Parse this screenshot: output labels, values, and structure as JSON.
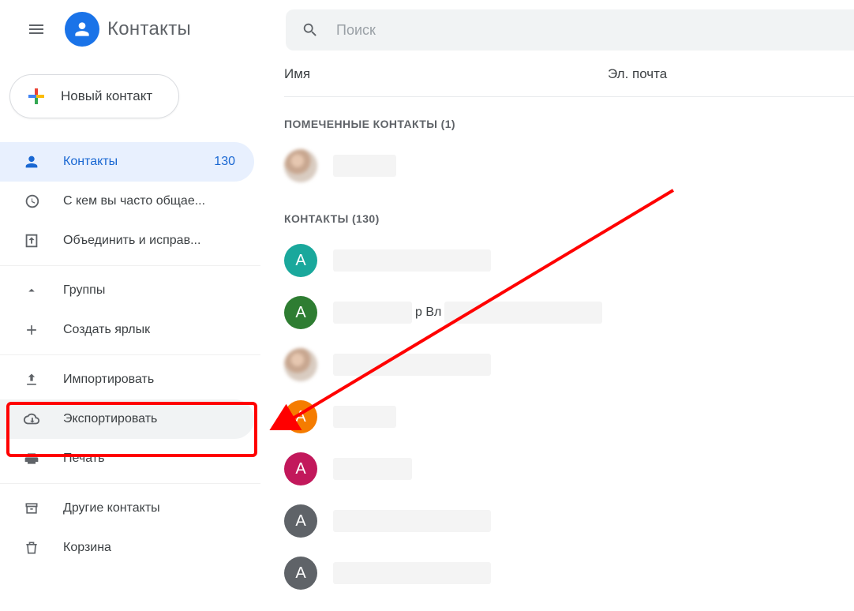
{
  "header": {
    "app_title": "Контакты",
    "search_placeholder": "Поиск"
  },
  "sidebar": {
    "new_contact": "Новый контакт",
    "nav": {
      "contacts": {
        "label": "Контакты",
        "count": "130"
      },
      "frequent": {
        "label": "С кем вы часто общае..."
      },
      "merge": {
        "label": "Объединить и исправ..."
      }
    },
    "groups": {
      "label": "Группы",
      "create": "Создать ярлык"
    },
    "io": {
      "import": "Импортировать",
      "export": "Экспортировать",
      "print": "Печать"
    },
    "other": {
      "other_contacts": "Другие контакты",
      "trash": "Корзина"
    }
  },
  "content": {
    "columns": {
      "name": "Имя",
      "email": "Эл. почта"
    },
    "starred_label": "ПОМЕЧЕННЫЕ КОНТАКТЫ (1)",
    "contacts_label": "КОНТАКТЫ (130)",
    "rows": [
      {
        "avatar_type": "photo"
      },
      {
        "letter": "А",
        "color": "#1aa89c"
      },
      {
        "letter": "А",
        "color": "#2e7d32",
        "fragment": "р Вл"
      },
      {
        "avatar_type": "photo"
      },
      {
        "letter": "А",
        "color": "#f57c00"
      },
      {
        "letter": "А",
        "color": "#c2185b"
      },
      {
        "letter": "А",
        "color": "#5f6368"
      },
      {
        "letter": "А",
        "color": "#5f6368"
      }
    ]
  }
}
